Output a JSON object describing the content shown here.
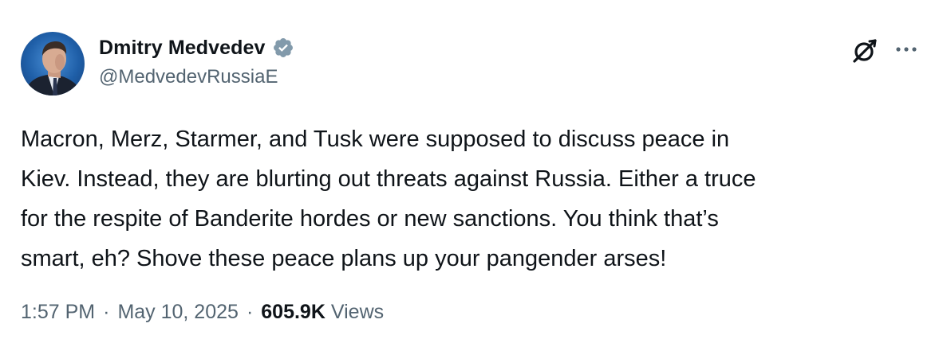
{
  "author": {
    "display_name": "Dmitry Medvedev",
    "handle": "@MedvedevRussiaE",
    "verified": true,
    "verified_color": "#829aab"
  },
  "icons": {
    "grok": "grok-icon",
    "more": "more-icon"
  },
  "tweet": {
    "text": "Macron, Merz, Starmer, and Tusk were supposed to discuss peace in\nKiev. Instead, they are blurting out threats against Russia. Either a truce\nfor the respite of Banderite hordes or new sanctions. You think that’s\nsmart, eh? Shove these peace plans up your pangender arses!",
    "time": "1:57 PM",
    "separator": "·",
    "date": "May 10, 2025",
    "views_count": "605.9K",
    "views_label": "Views"
  }
}
